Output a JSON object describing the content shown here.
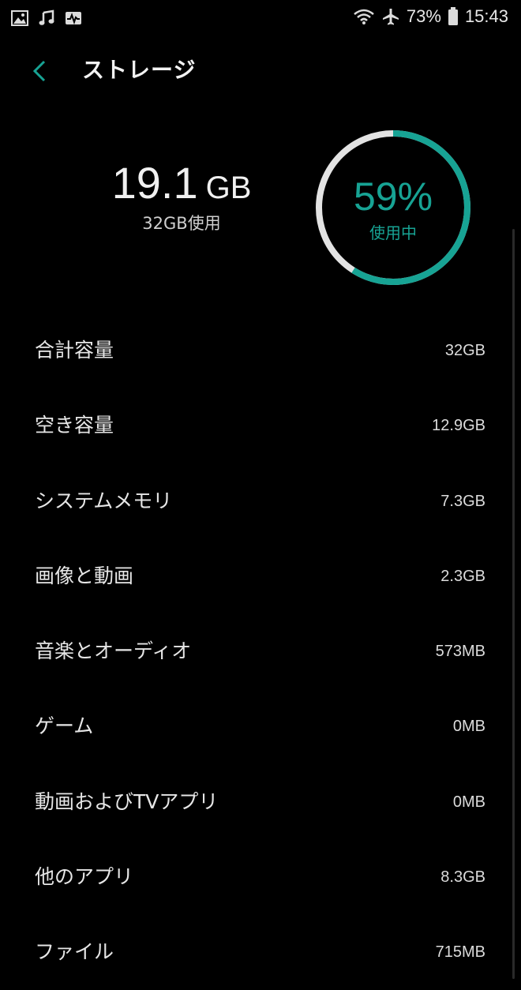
{
  "status_bar": {
    "battery": "73%",
    "time": "15:43",
    "icons_left": [
      "image-icon",
      "music-note-icon",
      "activity-icon"
    ],
    "icons_right": [
      "wifi-icon",
      "airplane-mode-icon",
      "battery-icon"
    ]
  },
  "header": {
    "title": "ストレージ"
  },
  "summary": {
    "used_value": "19.1",
    "used_unit": "GB",
    "total_label": "32GB使用",
    "percent_label": "59%",
    "percent_caption": "使用中",
    "percent_used": 0.59,
    "accent_color": "#17a394",
    "ring_track_color": "#e3e3e3"
  },
  "items": [
    {
      "label": "合計容量",
      "value": "32GB"
    },
    {
      "label": "空き容量",
      "value": "12.9GB"
    },
    {
      "label": "システムメモリ",
      "value": "7.3GB"
    },
    {
      "label": "画像と動画",
      "value": "2.3GB"
    },
    {
      "label": "音楽とオーディオ",
      "value": "573MB"
    },
    {
      "label": "ゲーム",
      "value": "0MB"
    },
    {
      "label": "動画およびTVアプリ",
      "value": "0MB"
    },
    {
      "label": "他のアプリ",
      "value": "8.3GB"
    },
    {
      "label": "ファイル",
      "value": "715MB"
    }
  ]
}
